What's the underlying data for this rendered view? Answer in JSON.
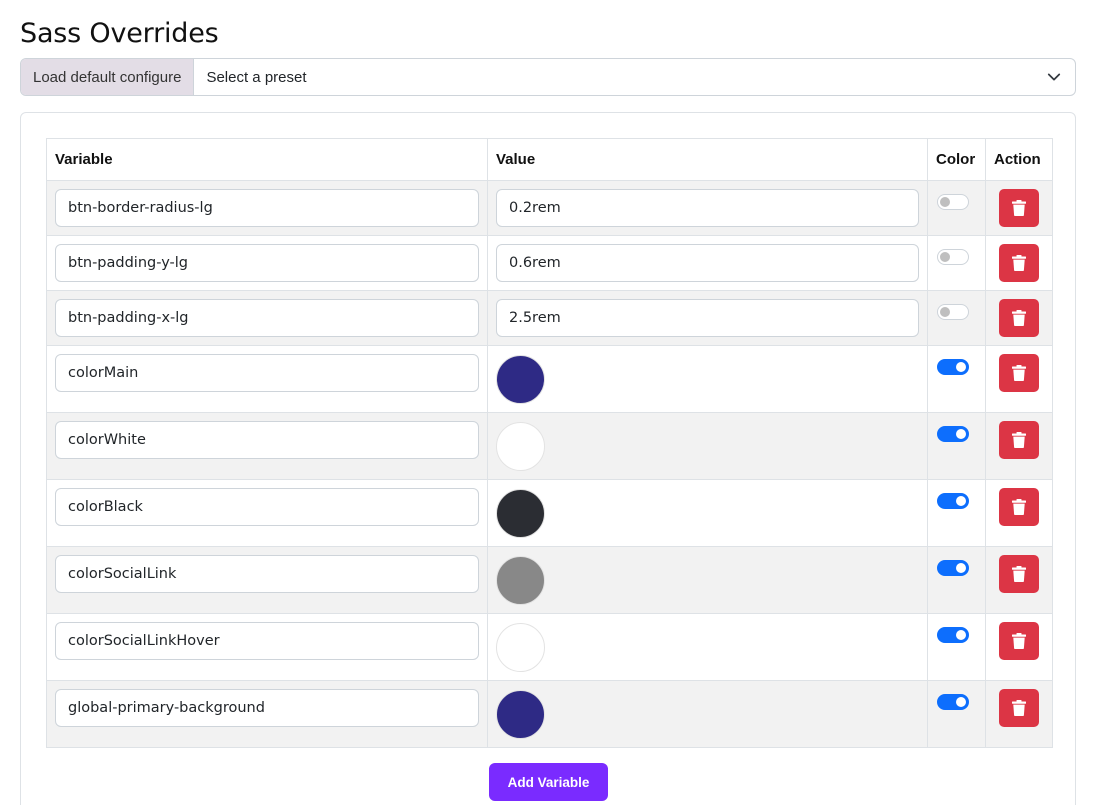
{
  "page": {
    "title": "Sass Overrides"
  },
  "preset": {
    "label": "Load default configure",
    "selected": "Select a preset"
  },
  "table": {
    "headers": {
      "variable": "Variable",
      "value": "Value",
      "color": "Color",
      "action": "Action"
    },
    "rows": [
      {
        "variable": "btn-border-radius-lg",
        "value": "0.2rem",
        "is_color": false
      },
      {
        "variable": "btn-padding-y-lg",
        "value": "0.6rem",
        "is_color": false
      },
      {
        "variable": "btn-padding-x-lg",
        "value": "2.5rem",
        "is_color": false
      },
      {
        "variable": "colorMain",
        "value": "#2e2a85",
        "is_color": true
      },
      {
        "variable": "colorWhite",
        "value": "#ffffff",
        "is_color": true
      },
      {
        "variable": "colorBlack",
        "value": "#2b2d33",
        "is_color": true
      },
      {
        "variable": "colorSocialLink",
        "value": "#888888",
        "is_color": true
      },
      {
        "variable": "colorSocialLinkHover",
        "value": "#ffffff",
        "is_color": true
      },
      {
        "variable": "global-primary-background",
        "value": "#2e2a85",
        "is_color": true
      }
    ]
  },
  "actions": {
    "add_variable": "Add Variable",
    "delete_icon": "trash-icon"
  },
  "colors": {
    "delete": "#dc3545",
    "toggle_on": "#0d6efd",
    "add_button": "#7a2bff"
  }
}
